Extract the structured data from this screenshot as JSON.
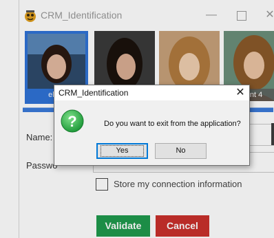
{
  "window": {
    "title": "CRM_Identification",
    "controls": {
      "minimize": "—",
      "maximize": "☐",
      "close": "✕"
    }
  },
  "gallery": {
    "items": [
      {
        "label": "elem",
        "selected": true
      },
      {
        "label": "",
        "selected": false
      },
      {
        "label": "",
        "selected": false
      },
      {
        "label": "ent 4",
        "selected": false
      }
    ]
  },
  "form": {
    "name_label": "Name:",
    "password_label": "Passwo",
    "name_value": "",
    "password_value": "",
    "remember_label": "Store my connection information",
    "remember_checked": false,
    "validate_label": "Validate",
    "cancel_label": "Cancel"
  },
  "dialog": {
    "title": "CRM_Identification",
    "close_glyph": "✕",
    "message": "Do you want to exit from the application?",
    "icon": "question-icon",
    "yes_label": "Yes",
    "no_label": "No"
  },
  "colors": {
    "selection_blue": "#2f72d6",
    "validate_green": "#1f9a4c",
    "cancel_red": "#c9302c",
    "question_green": "#2fb34a"
  }
}
